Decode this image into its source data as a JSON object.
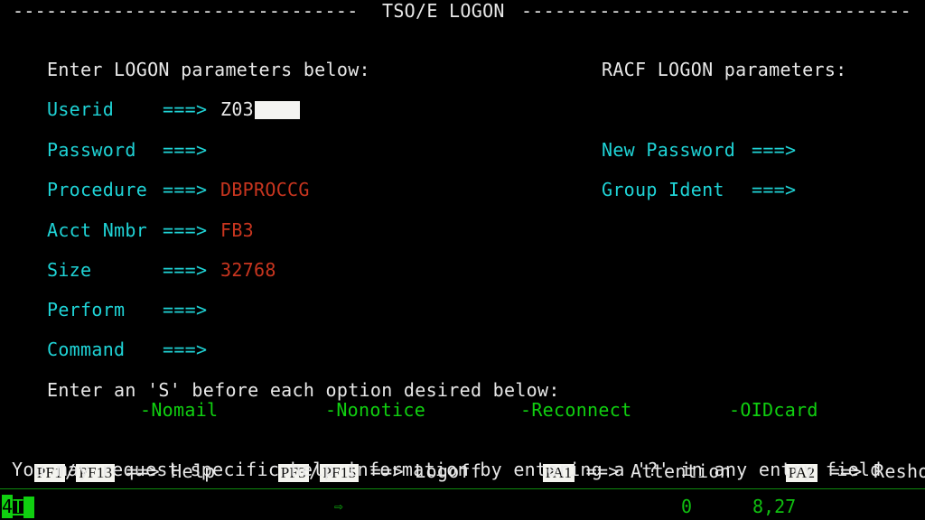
{
  "header": {
    "title": "TSO/E LOGON",
    "left_rule": "-------------------------------",
    "right_rule": "-----------------------------------"
  },
  "left_section": {
    "heading": "Enter LOGON parameters below:",
    "fields": [
      {
        "label": "Userid",
        "arrow": "===>",
        "value": "Z03",
        "redacted": true
      },
      {
        "label": "Password",
        "arrow": "===>",
        "value": ""
      },
      {
        "label": "Procedure",
        "arrow": "===>",
        "value": "DBPROCCG"
      },
      {
        "label": "Acct Nmbr",
        "arrow": "===>",
        "value": "FB3"
      },
      {
        "label": "Size",
        "arrow": "===>",
        "value": "32768"
      },
      {
        "label": "Perform",
        "arrow": "===>",
        "value": ""
      },
      {
        "label": "Command",
        "arrow": "===>",
        "value": ""
      }
    ]
  },
  "right_section": {
    "heading": "RACF LOGON parameters:",
    "fields": [
      {
        "label": "New Password",
        "arrow": "===>",
        "value": ""
      },
      {
        "label": "Group Ident",
        "arrow": "===>",
        "value": ""
      }
    ]
  },
  "options": {
    "prompt": "Enter an 'S' before each option desired below:",
    "items": [
      "-Nomail",
      "-Nonotice",
      "-Reconnect",
      "-OIDcard"
    ]
  },
  "pf_keys": {
    "help": {
      "key1": "PF1",
      "sep": "/",
      "key2": "PF13",
      "action": "==> Help"
    },
    "logoff": {
      "key1": "PF3",
      "sep": "/",
      "key2": "PF15",
      "action": "==> Logoff"
    },
    "attention": {
      "key1": "PA1",
      "action": "==> Attention"
    },
    "reshow": {
      "key1": "PA2",
      "action": "==> Reshow"
    }
  },
  "help_text": "You may request specific help information by entering a '?' in any entry field",
  "status_bar": {
    "session": "4",
    "mode": "T",
    "arrow_icon": "⇨",
    "message_count": "0",
    "cursor_position": "8,27"
  },
  "colors": {
    "background": "#000000",
    "label": "#1fd3d6",
    "value": "#c8351f",
    "text": "#e8e8e8",
    "option": "#10d010",
    "status": "#10c010"
  }
}
